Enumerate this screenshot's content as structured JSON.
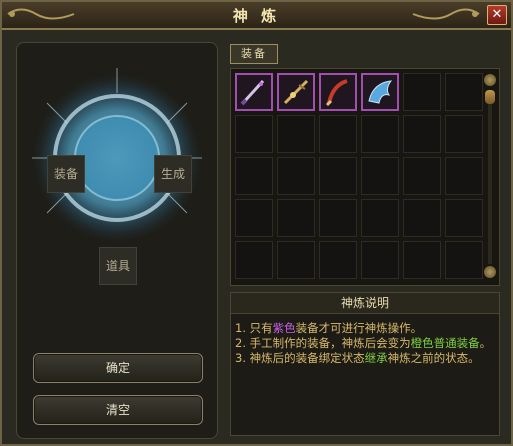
{
  "window": {
    "title": "神 炼",
    "close_glyph": "✕"
  },
  "left": {
    "equip_slot": "装备",
    "result_slot": "生成",
    "item_slot": "道具",
    "confirm_label": "确定",
    "clear_label": "清空"
  },
  "tab": {
    "label": "装备"
  },
  "grid": {
    "items": [
      {
        "name": "sword-purple-icon",
        "color": "#a34fb2"
      },
      {
        "name": "staff-gold-icon",
        "color": "#a34fb2"
      },
      {
        "name": "blade-red-icon",
        "color": "#a34fb2"
      },
      {
        "name": "wing-blue-icon",
        "color": "#a34fb2"
      }
    ]
  },
  "desc": {
    "title": "神炼说明",
    "line1_pre": "1. 只有",
    "line1_hl": "紫色",
    "line1_post": "装备才可进行神炼操作。",
    "line2_pre": "2. 手工制作的装备，神炼后会变为",
    "line2_hl": "橙色普通装备",
    "line2_post": "。",
    "line3_pre": "3. 神炼后的装备绑定状态",
    "line3_hl": "继承",
    "line3_post": "神炼之前的状态。"
  }
}
